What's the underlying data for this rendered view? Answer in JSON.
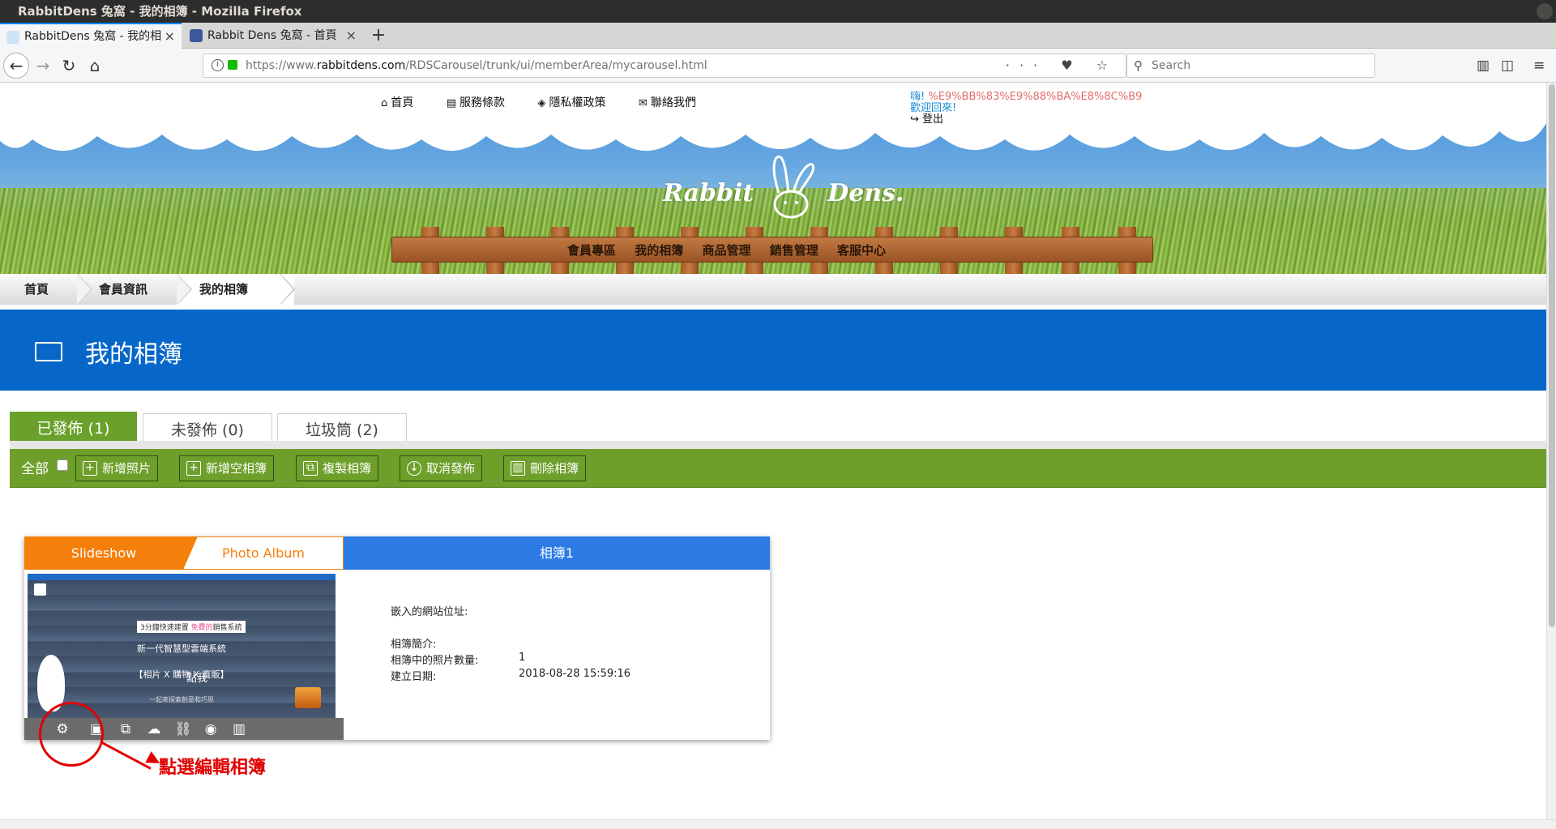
{
  "window": {
    "title": "RabbitDens 兔窩 - 我的相簿 - Mozilla Firefox"
  },
  "browser": {
    "tabs": [
      {
        "label": "RabbitDens 兔窩 - 我的相",
        "close": "×"
      },
      {
        "label": "Rabbit Dens 兔窩 - 首頁",
        "close": "×"
      }
    ],
    "new_tab": "+",
    "url_prefix": "https://www.",
    "url_domain": "rabbitdens.com",
    "url_path": "/RDSCarousel/trunk/ui/memberArea/mycarousel.html",
    "search_placeholder": "Search",
    "page_actions": "··· ♥ ☆"
  },
  "site": {
    "top_menu": [
      "首頁",
      "服務條款",
      "隱私權政策",
      "聯絡我們"
    ],
    "greeting_hi": "嗨!",
    "greeting_user": "%E9%BB%83%E9%88%BA%E8%8C%B9",
    "greeting_welcome": "歡迎回來!",
    "logout": "登出",
    "logo_left": "Rabbit",
    "logo_right": "Dens.",
    "fence_menu": [
      "會員專區",
      "我的相簿",
      "商品管理",
      "銷售管理",
      "客服中心"
    ]
  },
  "breadcrumb": [
    "首頁",
    "會員資訊",
    "我的相簿"
  ],
  "page_title": "我的相簿",
  "status_tabs": [
    {
      "label": "已發佈 (1)",
      "active": true
    },
    {
      "label": "未發佈 (0)",
      "active": false
    },
    {
      "label": "垃圾筒 (2)",
      "active": false
    }
  ],
  "toolbar": {
    "all_label": "全部",
    "buttons": [
      "新增照片",
      "新增空相簿",
      "複製相簿",
      "取消發佈",
      "刪除相簿"
    ]
  },
  "album": {
    "tab_slideshow": "Slideshow",
    "tab_photo_album": "Photo Album",
    "title": "相簿1",
    "thumb_text1_a": "3分鐘快速建置",
    "thumb_text1_b": "免費的",
    "thumb_text1_c": "銷售系統",
    "thumb_text2": "新一代智慧型雲端系統",
    "thumb_text3": "【相片 X 購物 X 直販】",
    "thumb_text4": "一起來探索創意和巧思",
    "thumb_tap": "點我",
    "embed_label": "嵌入的網站位址:",
    "intro_label": "相簿簡介:",
    "count_label": "相簿中的照片數量:",
    "count_value": "1",
    "date_label": "建立日期:",
    "date_value": "2018-08-28 15:59:16"
  },
  "annotation": {
    "text": "點選編輯相簿"
  },
  "colors": {
    "brand_blue": "#0767c9",
    "green_toolbar": "#6e9f2b",
    "orange": "#f57f0b",
    "album_blue": "#2c7be5",
    "annotation_red": "#e00000"
  }
}
